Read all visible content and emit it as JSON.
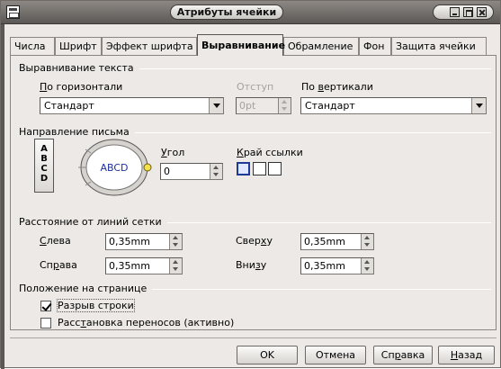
{
  "window": {
    "title": "Атрибуты ячейки"
  },
  "tabs": [
    {
      "label": "Числа"
    },
    {
      "label": "Шрифт"
    },
    {
      "label": "Эффект шрифта"
    },
    {
      "label": "Выравнивание"
    },
    {
      "label": "Обрамление"
    },
    {
      "label": "Фон"
    },
    {
      "label": "Защита ячейки"
    }
  ],
  "text_alignment": {
    "heading": "Выравнивание текста",
    "horizontal_label_ul": "П",
    "horizontal_label_rest": "о горизонтали",
    "horizontal_value": "Стандарт",
    "indent_label": "Отступ",
    "indent_value": "0pt",
    "vertical_label_a": "По ",
    "vertical_label_ul": "в",
    "vertical_label_b": "ертикали",
    "vertical_value": "Стандарт"
  },
  "writing_direction": {
    "heading": "Направление письма",
    "vertical_letters": [
      "A",
      "B",
      "C",
      "D"
    ],
    "dial_text": "ABCD",
    "angle_label_ul": "У",
    "angle_label_rest": "гол",
    "angle_value": "0",
    "edge_label_ul": "К",
    "edge_label_rest": "рай ссылки"
  },
  "grid_spacing": {
    "heading": "Расстояние от линий сетки",
    "left_ul": "С",
    "left_rest": "лева",
    "left_value": "0,35mm",
    "right_a": "Сп",
    "right_ul": "р",
    "right_b": "ава",
    "right_value": "0,35mm",
    "top_a": "Свер",
    "top_ul": "х",
    "top_b": "у",
    "top_value": "0,35mm",
    "bottom_a": "Вни",
    "bottom_ul": "з",
    "bottom_b": "у",
    "bottom_value": "0,35mm"
  },
  "page_position": {
    "heading": "Положение на странице",
    "wrap_label": "Разрыв строки",
    "wrap_checked": true,
    "hyphen_a": "Расс",
    "hyphen_ul": "т",
    "hyphen_b": "ановка переносов (активно)",
    "hyphen_checked": false
  },
  "buttons": {
    "ok": "OK",
    "cancel": "Отмена",
    "help_a": "Сп",
    "help_ul": "р",
    "help_b": "авка",
    "back_ul": "Н",
    "back_rest": "азад"
  },
  "colors": {
    "dialog_bg": "#ece9e6",
    "title_bar": "#5b5855",
    "dial_text": "#1e2f9c"
  }
}
